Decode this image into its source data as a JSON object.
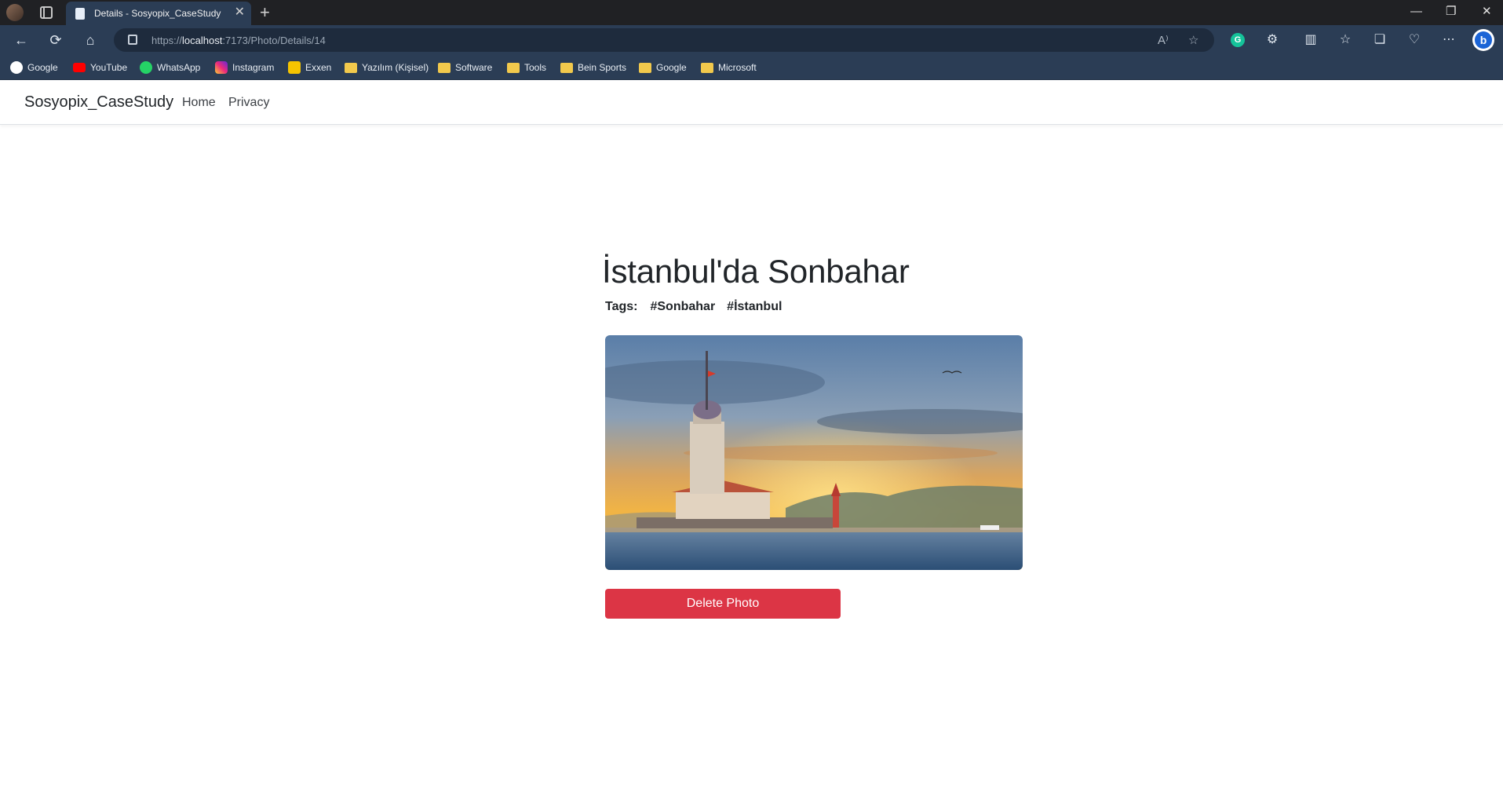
{
  "browser": {
    "tab_title": "Details - Sosyopix_CaseStudy",
    "tab_close": "✕",
    "new_tab": "+",
    "url_prefix": "https://",
    "url_host": "localhost",
    "url_path": ":7173/Photo/Details/14",
    "window_controls": [
      "—",
      "❐",
      "✕"
    ],
    "bookmarks": [
      {
        "label": "Google",
        "icon": "google-icon"
      },
      {
        "label": "YouTube",
        "icon": "youtube-icon"
      },
      {
        "label": "WhatsApp",
        "icon": "whatsapp-icon"
      },
      {
        "label": "Instagram",
        "icon": "instagram-icon"
      },
      {
        "label": "Exxen",
        "icon": "exxen-icon"
      },
      {
        "label": "Yazılım (Kişisel)",
        "icon": "folder-icon"
      },
      {
        "label": "Software",
        "icon": "folder-icon"
      },
      {
        "label": "Tools",
        "icon": "folder-icon"
      },
      {
        "label": "Bein Sports",
        "icon": "folder-icon"
      },
      {
        "label": "Google",
        "icon": "folder-icon"
      },
      {
        "label": "Microsoft",
        "icon": "folder-icon"
      }
    ]
  },
  "site": {
    "brand": "Sosyopix_CaseStudy",
    "nav": [
      {
        "label": "Home"
      },
      {
        "label": "Privacy"
      }
    ]
  },
  "photo": {
    "title": "İstanbul'da Sonbahar",
    "tags_label": "Tags:",
    "tags": [
      "#Sonbahar",
      "#İstanbul"
    ],
    "delete_label": "Delete Photo"
  },
  "colors": {
    "danger": "#dc3545",
    "browser_chrome": "#2b3d55"
  }
}
